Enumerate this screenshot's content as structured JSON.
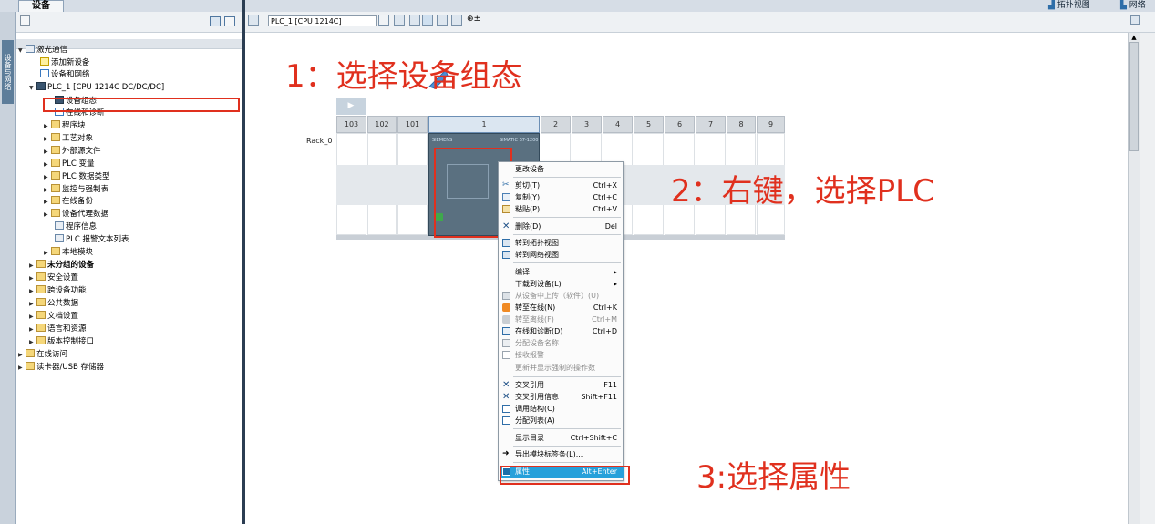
{
  "top": {
    "tab_devices": "设备",
    "right_topology": "拓扑视图",
    "right_network": "网络"
  },
  "sidebar": {
    "vertical_tab": "设备与网络"
  },
  "tree": {
    "items": [
      {
        "label": "激光通信"
      },
      {
        "label": "添加新设备"
      },
      {
        "label": "设备和网络"
      },
      {
        "label": "PLC_1 [CPU 1214C DC/DC/DC]"
      },
      {
        "label": "设备组态"
      },
      {
        "label": "在线和诊断"
      },
      {
        "label": "程序块"
      },
      {
        "label": "工艺对象"
      },
      {
        "label": "外部源文件"
      },
      {
        "label": "PLC 变量"
      },
      {
        "label": "PLC 数据类型"
      },
      {
        "label": "监控与强制表"
      },
      {
        "label": "在线备份"
      },
      {
        "label": "设备代理数据"
      },
      {
        "label": "程序信息"
      },
      {
        "label": "PLC 报警文本列表"
      },
      {
        "label": "本地模块"
      },
      {
        "label": "未分组的设备"
      },
      {
        "label": "安全设置"
      },
      {
        "label": "跨设备功能"
      },
      {
        "label": "公共数据"
      },
      {
        "label": "文档设置"
      },
      {
        "label": "语言和资源"
      },
      {
        "label": "版本控制接口"
      },
      {
        "label": "在线访问"
      },
      {
        "label": "读卡器/USB 存储器"
      }
    ]
  },
  "editor": {
    "device_select": "PLC_1 [CPU 1214C]",
    "rack_label": "Rack_0",
    "slots": [
      "103",
      "102",
      "101",
      "1",
      "2",
      "3",
      "4",
      "5",
      "6",
      "7",
      "8",
      "9"
    ],
    "plc_brand": "SIEMENS",
    "plc_model": "SIMATIC S7-1200"
  },
  "annotations": {
    "step1": "1：选择设备组态",
    "step2": "2：右键，选择PLC",
    "step3": "3:选择属性"
  },
  "context_menu": {
    "items": [
      {
        "label": "更改设备",
        "shortcut": ""
      },
      {
        "label": "剪切(T)",
        "shortcut": "Ctrl+X"
      },
      {
        "label": "复制(Y)",
        "shortcut": "Ctrl+C"
      },
      {
        "label": "粘贴(P)",
        "shortcut": "Ctrl+V"
      },
      {
        "label": "删除(D)",
        "shortcut": "Del"
      },
      {
        "label": "转到拓扑视图",
        "shortcut": ""
      },
      {
        "label": "转到网络视图",
        "shortcut": ""
      },
      {
        "label": "编译",
        "shortcut": "▸"
      },
      {
        "label": "下载到设备(L)",
        "shortcut": "▸"
      },
      {
        "label": "从设备中上传（软件）(U)",
        "shortcut": ""
      },
      {
        "label": "转至在线(N)",
        "shortcut": "Ctrl+K"
      },
      {
        "label": "转至离线(F)",
        "shortcut": "Ctrl+M"
      },
      {
        "label": "在线和诊断(D)",
        "shortcut": "Ctrl+D"
      },
      {
        "label": "分配设备名称",
        "shortcut": ""
      },
      {
        "label": "接收报警",
        "shortcut": ""
      },
      {
        "label": "更新并显示强制的操作数",
        "shortcut": ""
      },
      {
        "label": "交叉引用",
        "shortcut": "F11"
      },
      {
        "label": "交叉引用信息",
        "shortcut": "Shift+F11"
      },
      {
        "label": "调用结构(C)",
        "shortcut": ""
      },
      {
        "label": "分配列表(A)",
        "shortcut": ""
      },
      {
        "label": "显示目录",
        "shortcut": "Ctrl+Shift+C"
      },
      {
        "label": "导出模块标签条(L)...",
        "shortcut": ""
      },
      {
        "label": "属性",
        "shortcut": "Alt+Enter"
      }
    ]
  },
  "colors": {
    "annotation_red": "#e0301e",
    "menu_highlight": "#26a0da",
    "plc_module": "#5a7080"
  }
}
